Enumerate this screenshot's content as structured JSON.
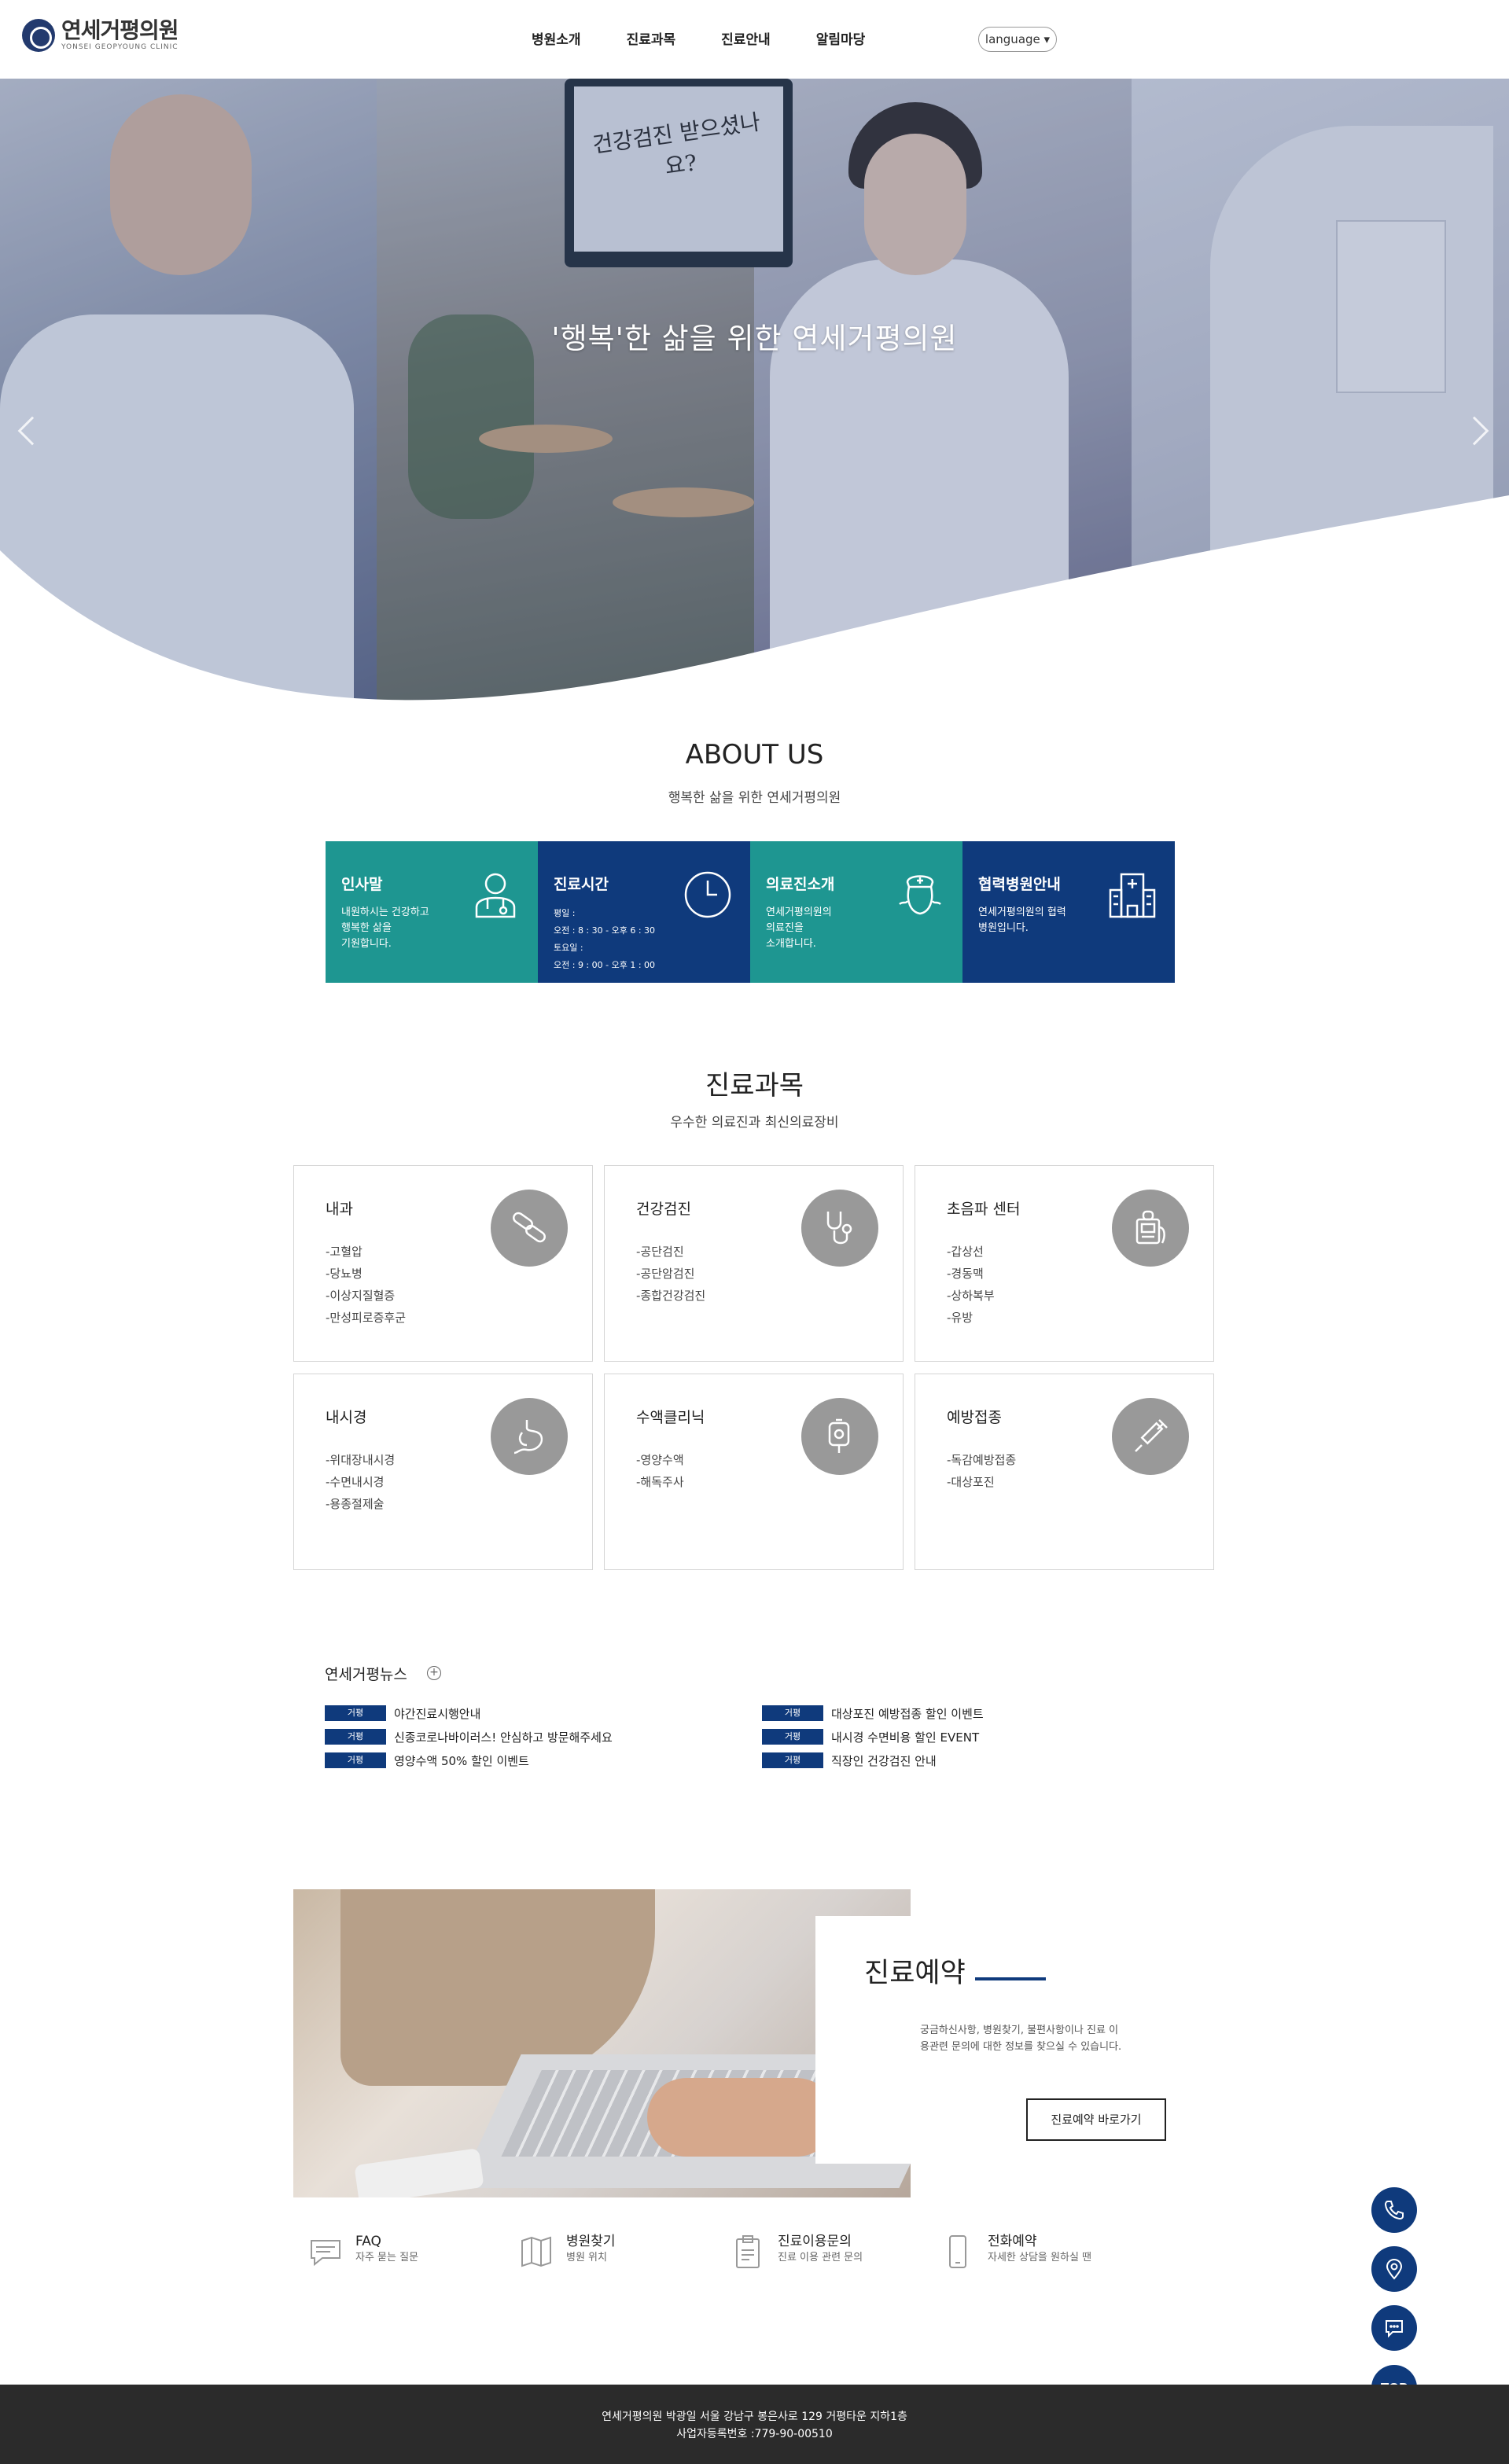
{
  "header": {
    "logo_name": "연세거평의원",
    "logo_sub": "YONSEI GEOPYOUNG CLINIC",
    "nav": [
      "병원소개",
      "진료과목",
      "진료안내",
      "알림마당"
    ],
    "language_label": "language ▾"
  },
  "hero": {
    "headline": "'행복'한 삶을 위한 연세거평의원",
    "tv_text": "건강검진 받으셨나요?"
  },
  "about": {
    "title": "ABOUT US",
    "subtitle": "행복한 삶을 위한 연세거평의원",
    "boxes": [
      {
        "title": "인사말",
        "text": "내원하시는 건강하고\n행복한 삶을\n기원합니다.",
        "icon": "doctor-icon"
      },
      {
        "title": "진료시간",
        "text": "평일 :\n오전 : 8 : 30 - 오후 6 : 30\n토요일 :\n오전 : 9 : 00 - 오후 1 : 00",
        "icon": "clock-icon"
      },
      {
        "title": "의료진소개",
        "text": "연세거평의원의\n의료진을\n소개합니다.",
        "icon": "nurse-icon"
      },
      {
        "title": "협력병원안내",
        "text": "연세거평의원의 협력\n병원입니다.",
        "icon": "hospital-icon"
      }
    ]
  },
  "departments": {
    "title": "진료과목",
    "subtitle": "우수한 의료진과 최신의료장비",
    "items": [
      {
        "title": "내과",
        "lines": [
          "-고혈압",
          "-당뇨병",
          "-이상지질혈증",
          "-만성피로증후군"
        ],
        "icon": "pill-icon"
      },
      {
        "title": "건강검진",
        "lines": [
          "-공단검진",
          "-공단암검진",
          "-종합건강검진"
        ],
        "icon": "stethoscope-icon"
      },
      {
        "title": "초음파 센터",
        "lines": [
          "-갑상선",
          "-경동맥",
          "-상하복부",
          "-유방"
        ],
        "icon": "ultrasound-icon"
      },
      {
        "title": "내시경",
        "lines": [
          "-위대장내시경",
          "-수면내시경",
          "-용종절제술"
        ],
        "icon": "stomach-icon"
      },
      {
        "title": "수액클리닉",
        "lines": [
          "-영양수액",
          "-해독주사"
        ],
        "icon": "iv-bag-icon"
      },
      {
        "title": "예방접종",
        "lines": [
          "-독감예방접종",
          "-대상포진"
        ],
        "icon": "syringe-icon"
      }
    ]
  },
  "news": {
    "title": "연세거평뉴스",
    "plus": "+",
    "badge": "거평",
    "left": [
      "야간진료시행안내",
      "신종코로나바이러스! 안심하고 방문해주세요",
      "영양수액 50% 할인 이벤트"
    ],
    "right": [
      "대상포진 예방접종 할인 이벤트",
      "내시경 수면비용 할인 EVENT",
      "직장인 건강검진 안내"
    ]
  },
  "reservation": {
    "title": "진료예약",
    "text": "궁금하신사항, 병원찾기, 불편사항이나 진료 이용관련 문의에 대한 정보를 찾으실 수 있습니다.",
    "button": "진료예약 바로가기"
  },
  "quick_links": [
    {
      "title": "FAQ",
      "sub": "자주 묻는 질문",
      "icon": "chat-bubble-icon"
    },
    {
      "title": "병원찾기",
      "sub": "병원 위치",
      "icon": "map-icon"
    },
    {
      "title": "진료이용문의",
      "sub": "진료 이용 관련 문의",
      "icon": "clipboard-icon"
    },
    {
      "title": "전화예약",
      "sub": "자세한 상담을 원하실 땐",
      "icon": "mobile-phone-icon"
    }
  ],
  "floating": {
    "top_label": "TOP"
  },
  "footer": {
    "line1": "연세거평의원 박광일 서울 강남구 봉은사로 129 거평타운 지하1층",
    "line2": "사업자등록번호 :779-90-00510"
  },
  "colors": {
    "teal": "#1e9691",
    "navy": "#0f3a7c",
    "footer": "#2b2b2b",
    "icon_gray": "#999999"
  }
}
